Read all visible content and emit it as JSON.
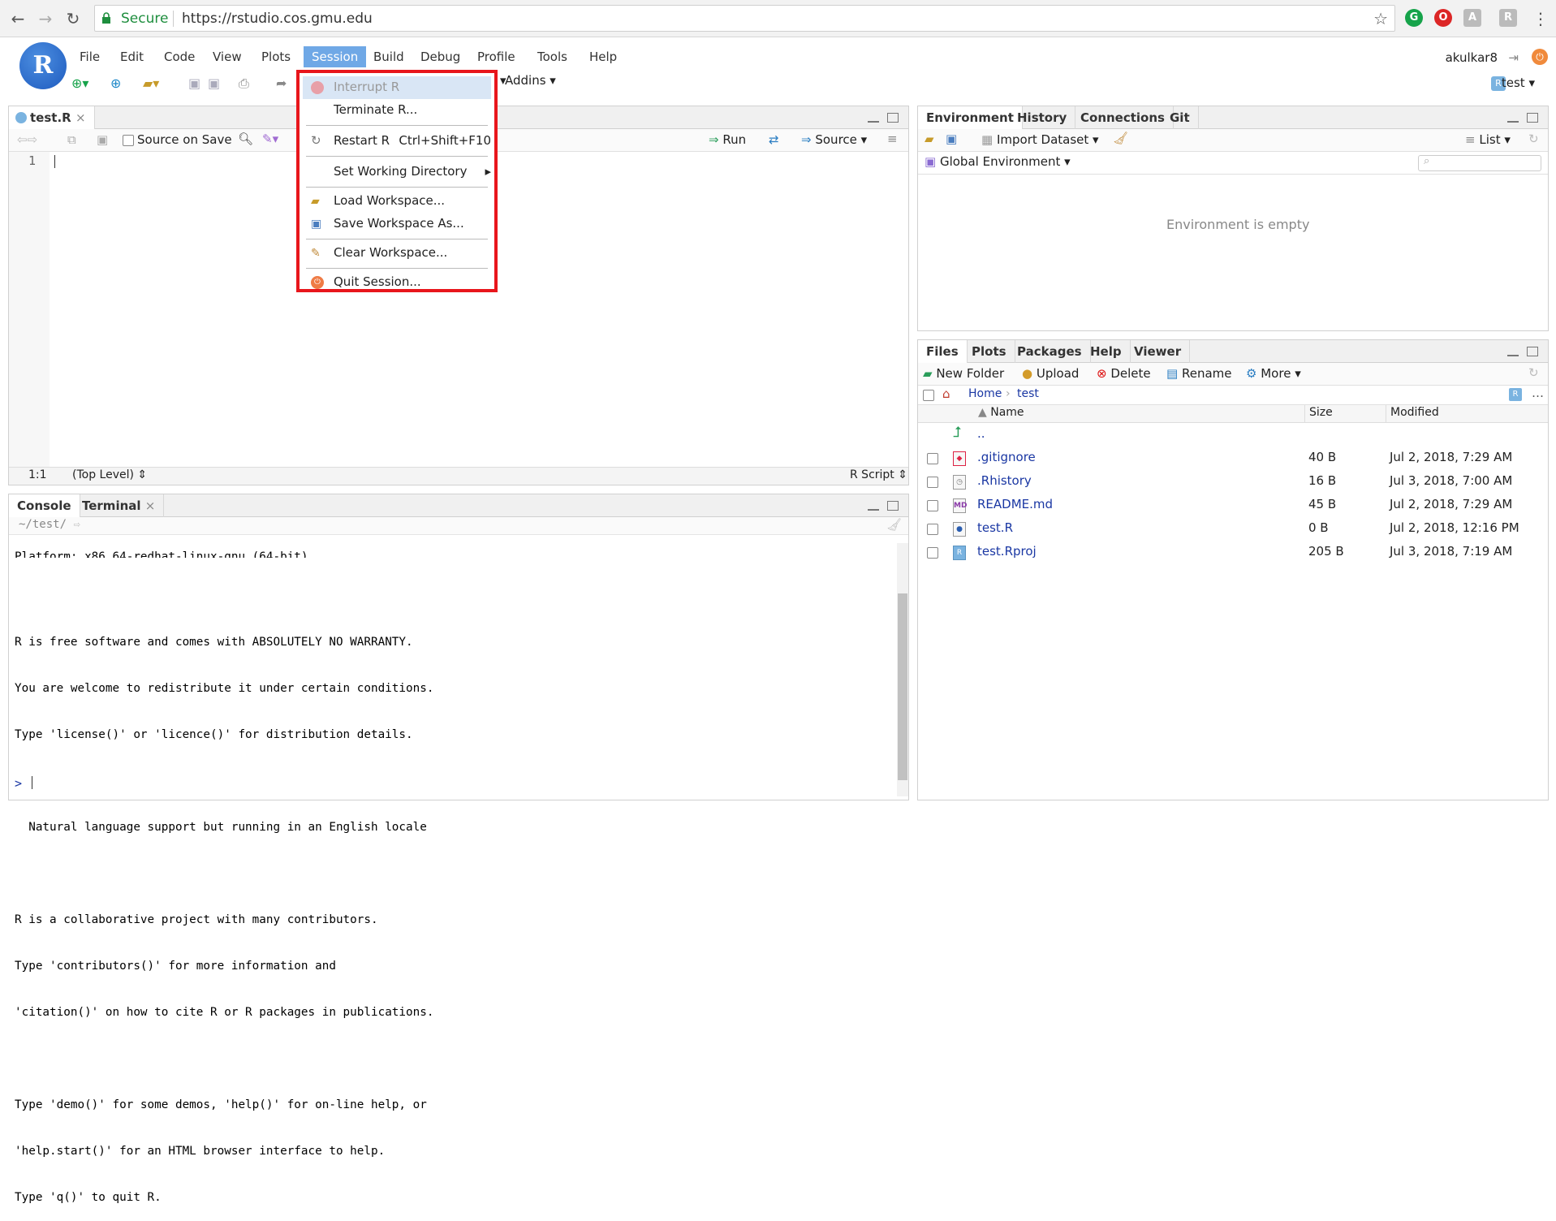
{
  "browser": {
    "secure_label": "Secure",
    "url": "https://rstudio.cos.gmu.edu"
  },
  "menu": {
    "logo": "R",
    "items": [
      "File",
      "Edit",
      "Code",
      "View",
      "Plots",
      "Session",
      "Build",
      "Debug",
      "Profile",
      "Tools",
      "Help"
    ],
    "active": "Session"
  },
  "toolbar": {
    "addins_label": "Addins"
  },
  "user": {
    "name": "akulkar8",
    "project": "test"
  },
  "session_menu": [
    {
      "label": "Interrupt R",
      "shortcut": "",
      "disabled": true,
      "icon": "stop-icon"
    },
    {
      "label": "Terminate R...",
      "shortcut": "",
      "disabled": false,
      "icon": ""
    },
    {
      "label": "Restart R",
      "shortcut": "Ctrl+Shift+F10",
      "disabled": false,
      "icon": "restart-icon"
    },
    {
      "label": "Set Working Directory",
      "shortcut": "",
      "disabled": false,
      "icon": "",
      "submenu": true
    },
    {
      "label": "Load Workspace...",
      "shortcut": "",
      "disabled": false,
      "icon": "folder-open-icon"
    },
    {
      "label": "Save Workspace As...",
      "shortcut": "",
      "disabled": false,
      "icon": "save-icon"
    },
    {
      "label": "Clear Workspace...",
      "shortcut": "",
      "disabled": false,
      "icon": "broom-icon"
    },
    {
      "label": "Quit Session...",
      "shortcut": "",
      "disabled": false,
      "icon": "power-icon"
    }
  ],
  "editor": {
    "tab_label": "test.R",
    "source_on_save": "Source on Save",
    "run_label": "Run",
    "source_label": "Source",
    "line_number": "1",
    "cursor_pos": "1:1",
    "scope": "(Top Level)",
    "file_type": "R Script"
  },
  "console": {
    "tabs": [
      "Console",
      "Terminal"
    ],
    "path": "~/test/",
    "lines": [
      "Platform: x86_64-redhat-linux-gnu (64-bit)",
      "",
      "R is free software and comes with ABSOLUTELY NO WARRANTY.",
      "You are welcome to redistribute it under certain conditions.",
      "Type 'license()' or 'licence()' for distribution details.",
      "",
      "  Natural language support but running in an English locale",
      "",
      "R is a collaborative project with many contributors.",
      "Type 'contributors()' for more information and",
      "'citation()' on how to cite R or R packages in publications.",
      "",
      "Type 'demo()' for some demos, 'help()' for on-line help, or",
      "'help.start()' for an HTML browser interface to help.",
      "Type 'q()' to quit R."
    ],
    "prompt": ">"
  },
  "environment": {
    "tabs": [
      "Environment",
      "History",
      "Connections",
      "Git"
    ],
    "import_label": "Import Dataset",
    "list_label": "List",
    "scope_label": "Global Environment",
    "empty_message": "Environment is empty"
  },
  "files": {
    "tabs": [
      "Files",
      "Plots",
      "Packages",
      "Help",
      "Viewer"
    ],
    "actions": [
      "New Folder",
      "Upload",
      "Delete",
      "Rename",
      "More"
    ],
    "breadcrumb": [
      "Home",
      "test"
    ],
    "headers": {
      "name": "Name",
      "size": "Size",
      "modified": "Modified"
    },
    "up_label": "..",
    "rows": [
      {
        "name": ".gitignore",
        "size": "40 B",
        "modified": "Jul 2, 2018, 7:29 AM",
        "icon": "git-icon"
      },
      {
        "name": ".Rhistory",
        "size": "16 B",
        "modified": "Jul 3, 2018, 7:00 AM",
        "icon": "history-icon"
      },
      {
        "name": "README.md",
        "size": "45 B",
        "modified": "Jul 2, 2018, 7:29 AM",
        "icon": "md-file-icon"
      },
      {
        "name": "test.R",
        "size": "0 B",
        "modified": "Jul 2, 2018, 12:16 PM",
        "icon": "r-file-icon"
      },
      {
        "name": "test.Rproj",
        "size": "205 B",
        "modified": "Jul 3, 2018, 7:19 AM",
        "icon": "rproj-icon"
      }
    ]
  }
}
